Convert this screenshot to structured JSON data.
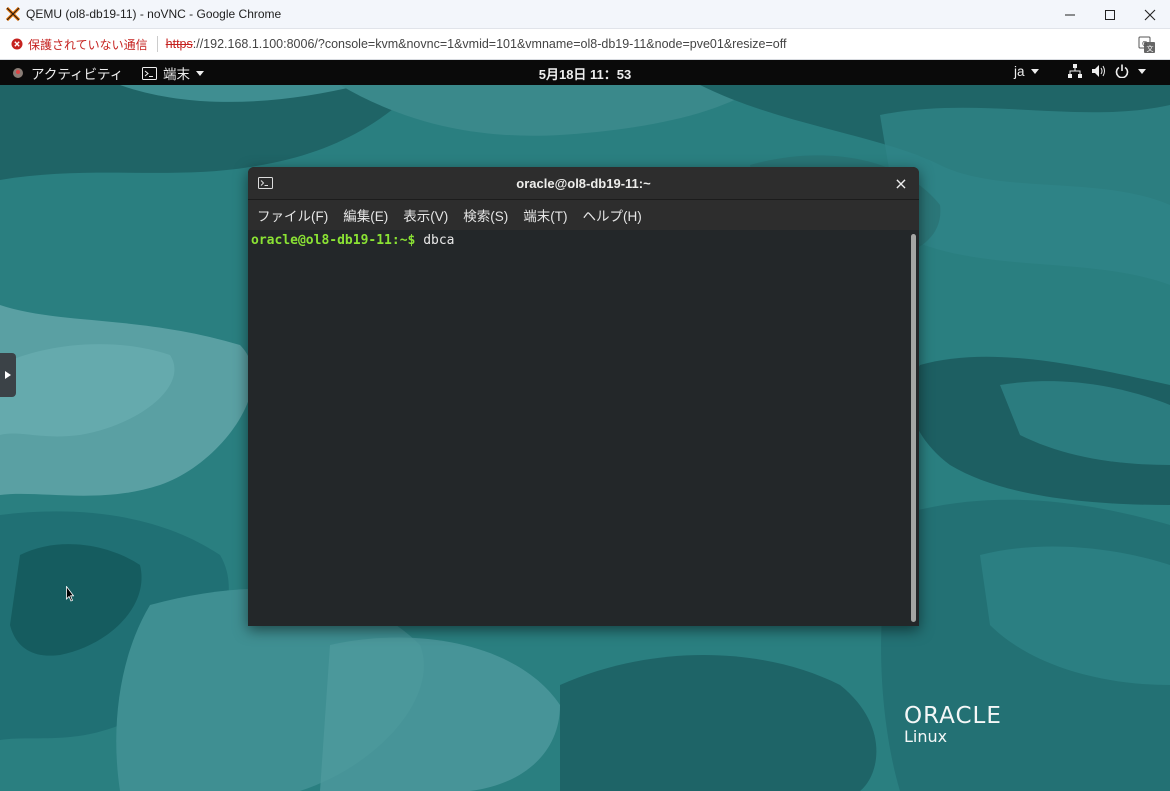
{
  "browser": {
    "window_title": "QEMU (ol8-db19-11) - noVNC - Google Chrome",
    "security_label": "保護されていない通信",
    "url_scheme": "https",
    "url_rest": "://192.168.1.100:8006/?console=kvm&novnc=1&vmid=101&vmname=ol8-db19-11&node=pve01&resize=off"
  },
  "gnome": {
    "activities_label": "アクティビティ",
    "app_menu_label": "端末",
    "clock": "5月18日  11：53",
    "input_lang": "ja"
  },
  "terminal": {
    "title": "oracle@ol8-db19-11:~",
    "close_glyph": "×",
    "menu": [
      "ファイル(F)",
      "編集(E)",
      "表示(V)",
      "検索(S)",
      "端末(T)",
      "ヘルプ(H)"
    ],
    "prompt": "oracle@ol8-db19-11:~$",
    "command": " dbca"
  },
  "desktop": {
    "logo_word": "ORACLE",
    "logo_sub": "Linux"
  },
  "colors": {
    "desktop_bg": "#2a7f80",
    "prompt_green": "#8ae234",
    "insecure_red": "#c5221f"
  },
  "icons": [
    "proxmox-icon",
    "minimize-icon",
    "maximize-icon",
    "close-icon",
    "insecure-icon",
    "translate-icon",
    "user-status-icon",
    "terminal-icon",
    "network-icon",
    "volume-icon",
    "power-icon",
    "novnc-handle-icon",
    "cursor-icon"
  ]
}
